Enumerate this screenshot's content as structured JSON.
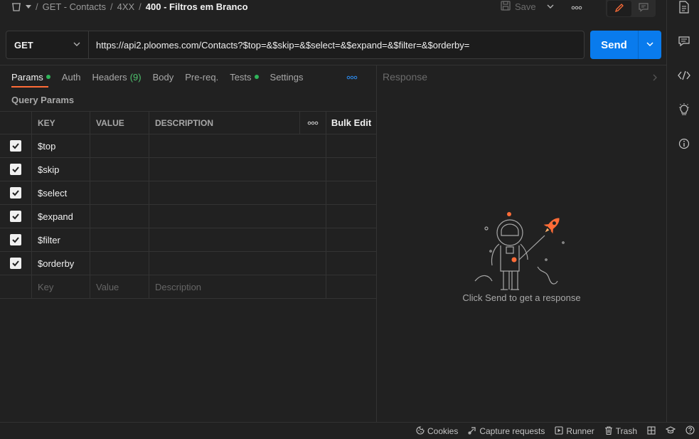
{
  "breadcrumb": {
    "items": [
      "GET - Contacts",
      "4XX"
    ],
    "current": "400 - Filtros em Branco"
  },
  "toolbar": {
    "save_label": "Save"
  },
  "request": {
    "method": "GET",
    "url": "https://api2.ploomes.com/Contacts?$top=&$skip=&$select=&$expand=&$filter=&$orderby=",
    "send_label": "Send"
  },
  "tabs": [
    {
      "label": "Params",
      "indicator": "dot"
    },
    {
      "label": "Auth"
    },
    {
      "label": "Headers",
      "count": "(9)"
    },
    {
      "label": "Body"
    },
    {
      "label": "Pre-req."
    },
    {
      "label": "Tests",
      "indicator": "dot"
    },
    {
      "label": "Settings"
    }
  ],
  "params": {
    "section_label": "Query Params",
    "columns": {
      "key": "KEY",
      "value": "VALUE",
      "description": "DESCRIPTION",
      "bulk_edit": "Bulk Edit"
    },
    "rows": [
      {
        "key": "$top",
        "checked": true
      },
      {
        "key": "$skip",
        "checked": true
      },
      {
        "key": "$select",
        "checked": true
      },
      {
        "key": "$expand",
        "checked": true
      },
      {
        "key": "$filter",
        "checked": true
      },
      {
        "key": "$orderby",
        "checked": true
      }
    ],
    "placeholders": {
      "key": "Key",
      "value": "Value",
      "description": "Description"
    }
  },
  "response": {
    "title": "Response",
    "hint": "Click Send to get a response"
  },
  "statusbar": {
    "cookies": "Cookies",
    "capture": "Capture requests",
    "runner": "Runner",
    "trash": "Trash"
  },
  "colors": {
    "accent": "#ff6c37",
    "send": "#097bed",
    "indicator": "#2fb55a",
    "count": "#4fc36e"
  }
}
